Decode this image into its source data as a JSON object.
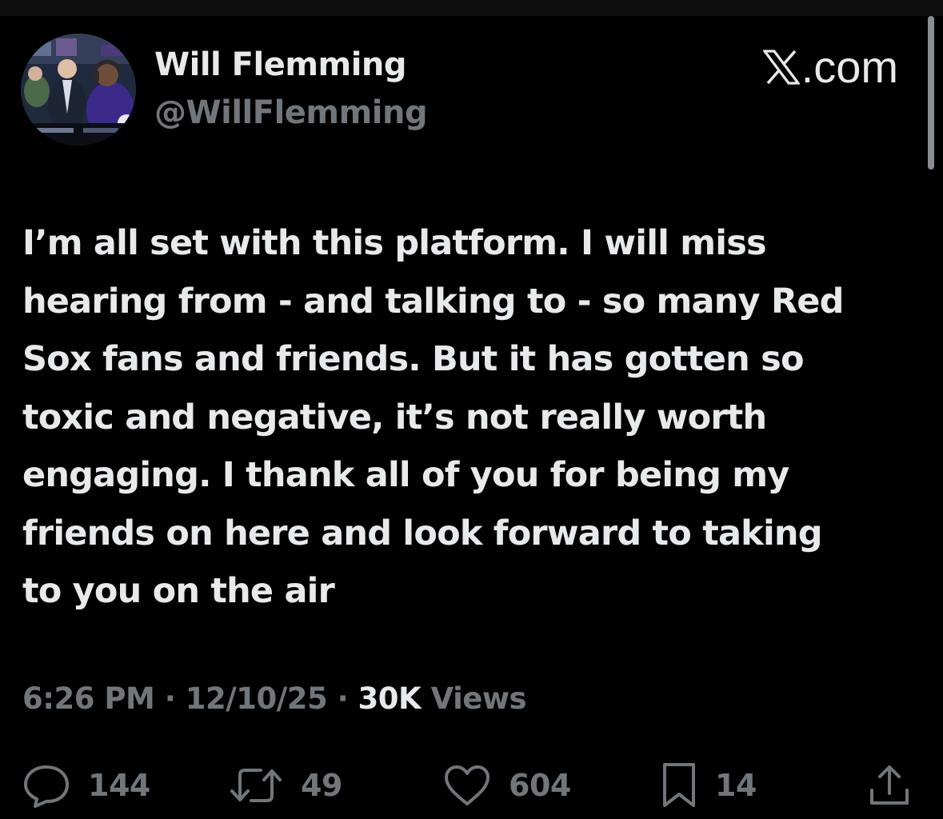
{
  "author": {
    "display_name": "Will Flemming",
    "handle": "@WillFlemming"
  },
  "brand": {
    "label": ".com",
    "icon": "x-logo-icon"
  },
  "tweet": {
    "lines": [
      "I’m all set with this platform. I will miss",
      "hearing from - and talking to - so many Red",
      "Sox fans and friends. But it has gotten so",
      "toxic and negative, it’s not really worth",
      "engaging. I thank all of you for being my",
      "friends on here and look forward to taking",
      "to you on the air"
    ]
  },
  "meta": {
    "time": "6:26 PM",
    "separator": "·",
    "date": "12/10/25",
    "views_count": "30K",
    "views_label": "Views"
  },
  "actions": {
    "replies": {
      "icon": "reply-icon",
      "count": "144"
    },
    "reposts": {
      "icon": "repost-icon",
      "count": "49"
    },
    "likes": {
      "icon": "heart-icon",
      "count": "604"
    },
    "bookmarks": {
      "icon": "bookmark-icon",
      "count": "14"
    },
    "share": {
      "icon": "share-icon"
    }
  },
  "colors": {
    "background": "#000000",
    "primary_text": "#e7e9ea",
    "secondary_text": "#71767b"
  }
}
